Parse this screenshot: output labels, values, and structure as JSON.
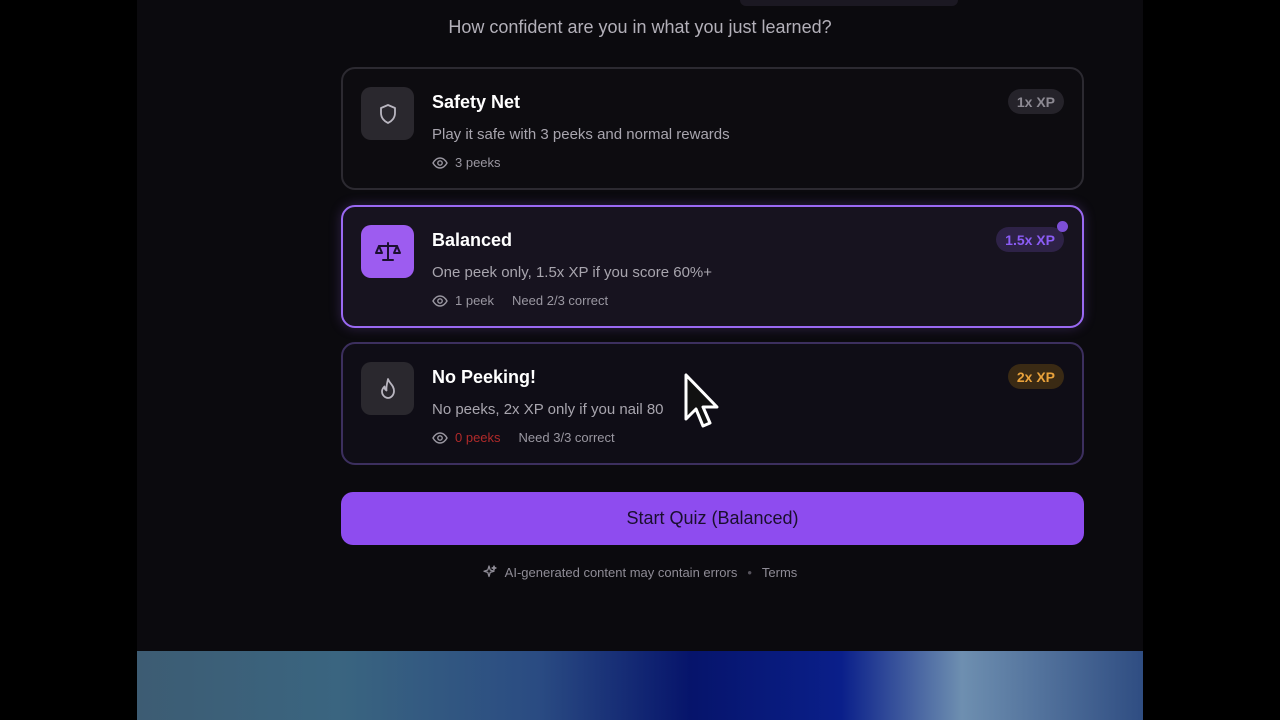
{
  "prompt": "How confident are you in what you just learned?",
  "options": [
    {
      "id": "safety-net",
      "title": "Safety Net",
      "description": "Play it safe with 3 peeks and normal rewards",
      "peeks": "3 peeks",
      "requirement": "",
      "xp": "1x XP",
      "icon": "shield-icon",
      "selected": false
    },
    {
      "id": "balanced",
      "title": "Balanced",
      "description": "One peek only, 1.5x XP if you score 60%+",
      "peeks": "1 peek",
      "requirement": "Need 2/3 correct",
      "xp": "1.5x XP",
      "icon": "scale-icon",
      "selected": true
    },
    {
      "id": "no-peeking",
      "title": "No Peeking!",
      "description": "No peeks, 2x XP only if you nail 80",
      "peeks": "0 peeks",
      "requirement": "Need 3/3 correct",
      "xp": "2x XP",
      "icon": "flame-icon",
      "selected": false
    }
  ],
  "start_button": "Start Quiz (Balanced)",
  "footer": {
    "disclaimer": "AI-generated content may contain errors",
    "terms": "Terms"
  },
  "colors": {
    "accent": "#8e4cef",
    "selected_border": "#9a69f2",
    "xp_gold": "#e9a23b",
    "danger": "#b02a2a"
  }
}
